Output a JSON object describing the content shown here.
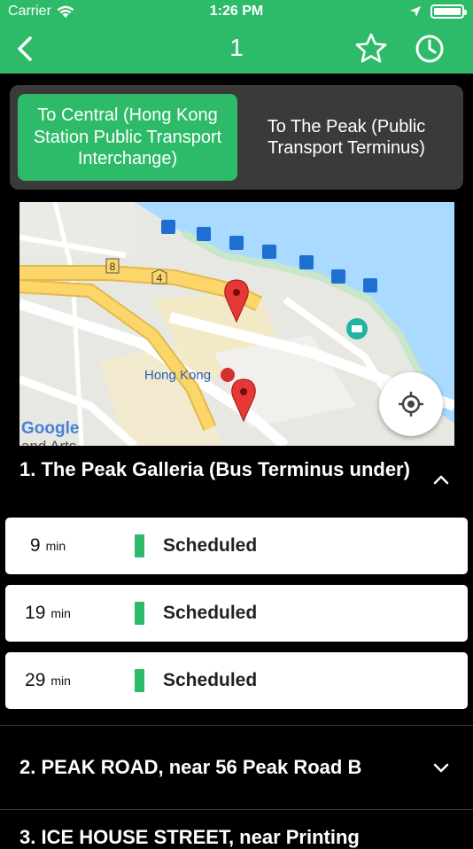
{
  "status_bar": {
    "carrier": "Carrier",
    "time": "1:26 PM"
  },
  "nav": {
    "title": "1"
  },
  "direction_toggle": {
    "options": [
      {
        "label": "To Central (Hong Kong Station Public Transport Interchange)",
        "selected": true
      },
      {
        "label": "To The Peak (Public Transport Terminus)",
        "selected": false
      }
    ]
  },
  "map": {
    "place_label": "Hong Kong",
    "attribution": "Google",
    "partial_label": "and Arts",
    "road_badges": [
      "8",
      "4"
    ]
  },
  "stops": [
    {
      "title": "1. The Peak Galleria (Bus Terminus under)",
      "expanded": true,
      "etas": [
        {
          "minutes": "9",
          "unit": "min",
          "status": "Scheduled"
        },
        {
          "minutes": "19",
          "unit": "min",
          "status": "Scheduled"
        },
        {
          "minutes": "29",
          "unit": "min",
          "status": "Scheduled"
        }
      ]
    },
    {
      "title": "2. PEAK ROAD, near 56 Peak Road B",
      "expanded": false
    },
    {
      "title": "3. ICE HOUSE STREET, near Printing",
      "expanded": false
    }
  ],
  "colors": {
    "brand_green": "#2dbb69",
    "toggle_bg": "#3a3a3a",
    "background": "#000000",
    "pin_red": "#e53935"
  }
}
